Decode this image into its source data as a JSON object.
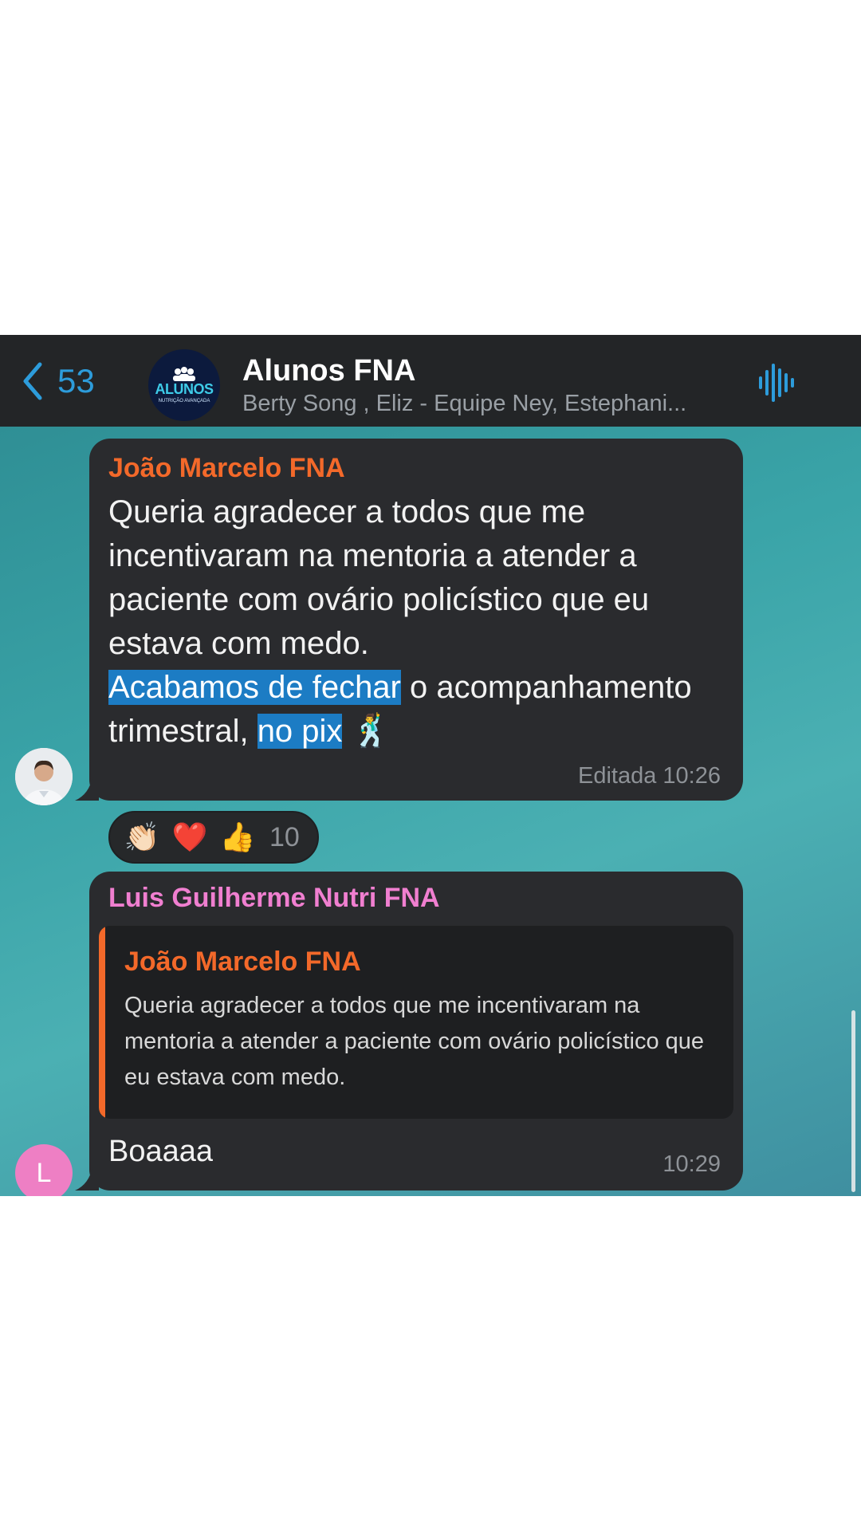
{
  "header": {
    "back_count": "53",
    "title": "Alunos FNA",
    "members": "Berty Song , Eliz - Equipe Ney, Estephani...",
    "avatar_logo": "ALUNOS",
    "avatar_sub": "NUTRIÇÃO AVANÇADA",
    "icons": {
      "back": "chevron-left-icon",
      "voice": "voice-wave-icon"
    }
  },
  "messages": [
    {
      "sender": "João Marcelo FNA",
      "text_part1": "Queria agradecer a todos que me incentivaram na mentoria a atender a paciente com ovário policístico que eu estava com medo.",
      "highlight1": "Acabamos de fechar",
      "text_part2": " o acompanhamento trimestral, ",
      "highlight2": "no pix",
      "emoji": "🕺",
      "meta": "Editada 10:26",
      "reactions": {
        "emojis": [
          "👏🏻",
          "❤️",
          "👍"
        ],
        "count": "10"
      }
    },
    {
      "sender": "Luis Guilherme Nutri FNA",
      "avatar_initial": "L",
      "reply_to": {
        "sender": "João Marcelo FNA",
        "text": "Queria agradecer a todos que me incentivaram na mentoria a atender a paciente com ovário policístico que eu estava com medo."
      },
      "text": "Boaaaa",
      "meta": "10:29"
    }
  ],
  "colors": {
    "accent": "#2d9cdb",
    "sender_orange": "#f3692a",
    "sender_pink": "#f07fd0",
    "bubble": "#2a2b2e",
    "header": "#232527",
    "highlight": "#1c7cc4"
  }
}
